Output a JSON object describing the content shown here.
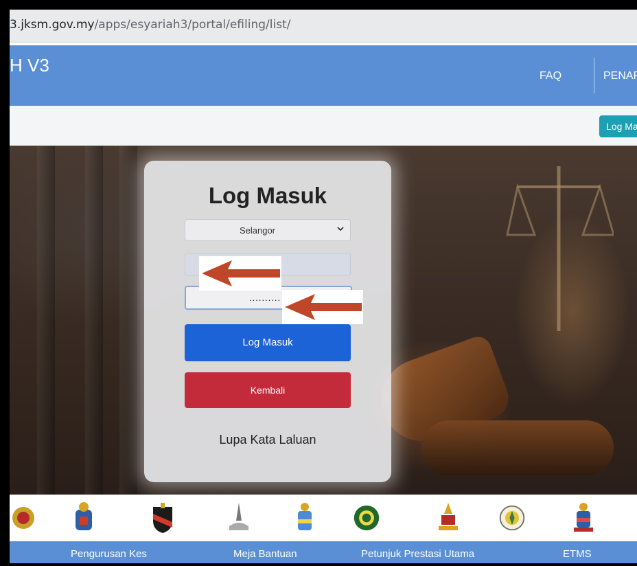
{
  "browser": {
    "url_host": "3.jksm.gov.my",
    "url_path": "/apps/esyariah3/portal/efiling/list/"
  },
  "header": {
    "brand": "H V3",
    "nav": {
      "faq": "FAQ",
      "penar": "PENAR"
    }
  },
  "subbar": {
    "login_button": "Log Ma"
  },
  "login": {
    "title": "Log Masuk",
    "state_select": {
      "value": "Selangor"
    },
    "password_mask": "..........",
    "submit_label": "Log Masuk",
    "back_label": "Kembali",
    "forgot_label": "Lupa Kata Laluan"
  },
  "footer": {
    "nav": [
      "Pengurusan Kes",
      "Meja Bantuan",
      "Petunjuk Prestasi Utama",
      "ETMS"
    ]
  },
  "colors": {
    "header_blue": "#5a8fd6",
    "teal_button": "#1ba0b4",
    "primary_button": "#1d63d8",
    "danger_button": "#c42b3a",
    "arrow_red": "#c0462a"
  },
  "logos": [
    "state-crest-icon",
    "state-crest-icon",
    "state-shield-icon",
    "state-crest-icon",
    "state-crest-icon",
    "state-wreath-icon",
    "state-crest-icon",
    "state-seal-icon",
    "state-crest-icon",
    "state-crest-icon"
  ]
}
